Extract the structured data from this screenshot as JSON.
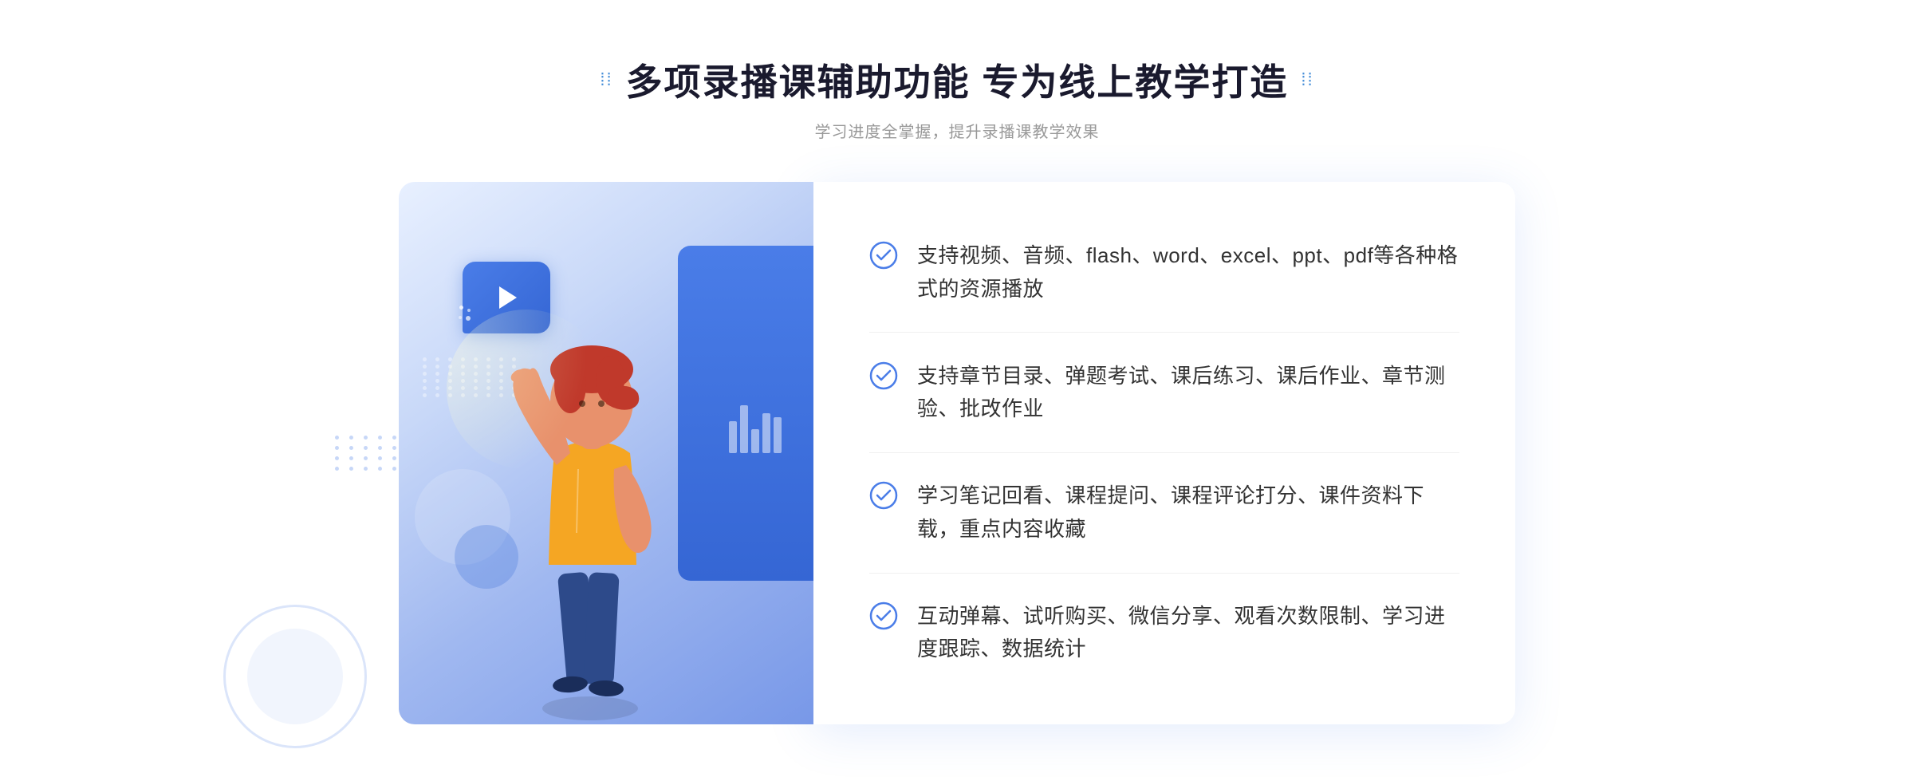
{
  "header": {
    "title_dots_left": "⁞⁞",
    "title_dots_right": "⁞⁞",
    "main_title": "多项录播课辅助功能 专为线上教学打造",
    "subtitle": "学习进度全掌握，提升录播课教学效果"
  },
  "features": [
    {
      "id": 1,
      "text": "支持视频、音频、flash、word、excel、ppt、pdf等各种格式的资源播放"
    },
    {
      "id": 2,
      "text": "支持章节目录、弹题考试、课后练习、课后作业、章节测验、批改作业"
    },
    {
      "id": 3,
      "text": "学习笔记回看、课程提问、课程评论打分、课件资料下载，重点内容收藏"
    },
    {
      "id": 4,
      "text": "互动弹幕、试听购买、微信分享、观看次数限制、学习进度跟踪、数据统计"
    }
  ],
  "colors": {
    "accent_blue": "#4a7de8",
    "title_color": "#1a1a2e",
    "text_color": "#333333",
    "subtitle_color": "#999999",
    "check_color": "#4a7de8",
    "gradient_start": "#e8f0ff",
    "gradient_end": "#7898e8"
  },
  "icons": {
    "check": "check-circle",
    "play": "play-triangle",
    "arrows": "double-chevron-right"
  }
}
